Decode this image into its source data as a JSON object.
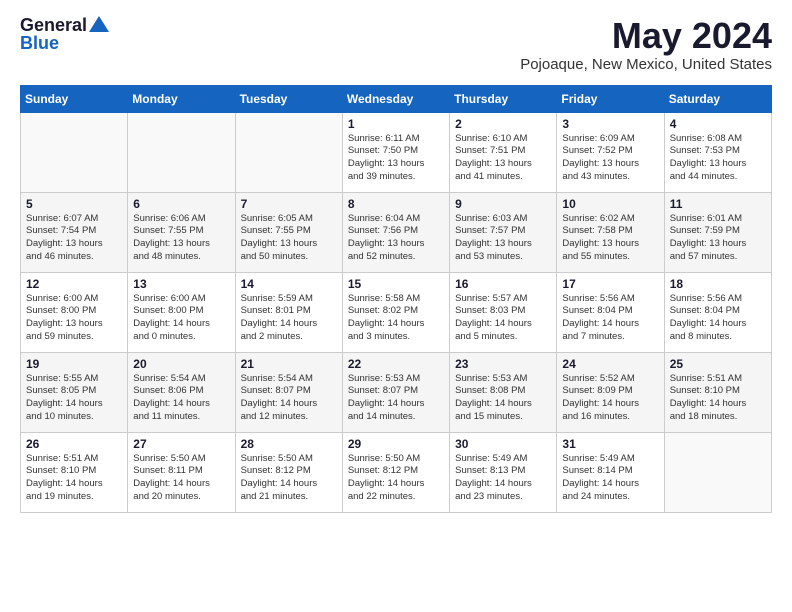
{
  "header": {
    "logo_general": "General",
    "logo_blue": "Blue",
    "month_title": "May 2024",
    "location": "Pojoaque, New Mexico, United States"
  },
  "days_of_week": [
    "Sunday",
    "Monday",
    "Tuesday",
    "Wednesday",
    "Thursday",
    "Friday",
    "Saturday"
  ],
  "weeks": [
    [
      {
        "day": "",
        "info": ""
      },
      {
        "day": "",
        "info": ""
      },
      {
        "day": "",
        "info": ""
      },
      {
        "day": "1",
        "info": "Sunrise: 6:11 AM\nSunset: 7:50 PM\nDaylight: 13 hours\nand 39 minutes."
      },
      {
        "day": "2",
        "info": "Sunrise: 6:10 AM\nSunset: 7:51 PM\nDaylight: 13 hours\nand 41 minutes."
      },
      {
        "day": "3",
        "info": "Sunrise: 6:09 AM\nSunset: 7:52 PM\nDaylight: 13 hours\nand 43 minutes."
      },
      {
        "day": "4",
        "info": "Sunrise: 6:08 AM\nSunset: 7:53 PM\nDaylight: 13 hours\nand 44 minutes."
      }
    ],
    [
      {
        "day": "5",
        "info": "Sunrise: 6:07 AM\nSunset: 7:54 PM\nDaylight: 13 hours\nand 46 minutes."
      },
      {
        "day": "6",
        "info": "Sunrise: 6:06 AM\nSunset: 7:55 PM\nDaylight: 13 hours\nand 48 minutes."
      },
      {
        "day": "7",
        "info": "Sunrise: 6:05 AM\nSunset: 7:55 PM\nDaylight: 13 hours\nand 50 minutes."
      },
      {
        "day": "8",
        "info": "Sunrise: 6:04 AM\nSunset: 7:56 PM\nDaylight: 13 hours\nand 52 minutes."
      },
      {
        "day": "9",
        "info": "Sunrise: 6:03 AM\nSunset: 7:57 PM\nDaylight: 13 hours\nand 53 minutes."
      },
      {
        "day": "10",
        "info": "Sunrise: 6:02 AM\nSunset: 7:58 PM\nDaylight: 13 hours\nand 55 minutes."
      },
      {
        "day": "11",
        "info": "Sunrise: 6:01 AM\nSunset: 7:59 PM\nDaylight: 13 hours\nand 57 minutes."
      }
    ],
    [
      {
        "day": "12",
        "info": "Sunrise: 6:00 AM\nSunset: 8:00 PM\nDaylight: 13 hours\nand 59 minutes."
      },
      {
        "day": "13",
        "info": "Sunrise: 6:00 AM\nSunset: 8:00 PM\nDaylight: 14 hours\nand 0 minutes."
      },
      {
        "day": "14",
        "info": "Sunrise: 5:59 AM\nSunset: 8:01 PM\nDaylight: 14 hours\nand 2 minutes."
      },
      {
        "day": "15",
        "info": "Sunrise: 5:58 AM\nSunset: 8:02 PM\nDaylight: 14 hours\nand 3 minutes."
      },
      {
        "day": "16",
        "info": "Sunrise: 5:57 AM\nSunset: 8:03 PM\nDaylight: 14 hours\nand 5 minutes."
      },
      {
        "day": "17",
        "info": "Sunrise: 5:56 AM\nSunset: 8:04 PM\nDaylight: 14 hours\nand 7 minutes."
      },
      {
        "day": "18",
        "info": "Sunrise: 5:56 AM\nSunset: 8:04 PM\nDaylight: 14 hours\nand 8 minutes."
      }
    ],
    [
      {
        "day": "19",
        "info": "Sunrise: 5:55 AM\nSunset: 8:05 PM\nDaylight: 14 hours\nand 10 minutes."
      },
      {
        "day": "20",
        "info": "Sunrise: 5:54 AM\nSunset: 8:06 PM\nDaylight: 14 hours\nand 11 minutes."
      },
      {
        "day": "21",
        "info": "Sunrise: 5:54 AM\nSunset: 8:07 PM\nDaylight: 14 hours\nand 12 minutes."
      },
      {
        "day": "22",
        "info": "Sunrise: 5:53 AM\nSunset: 8:07 PM\nDaylight: 14 hours\nand 14 minutes."
      },
      {
        "day": "23",
        "info": "Sunrise: 5:53 AM\nSunset: 8:08 PM\nDaylight: 14 hours\nand 15 minutes."
      },
      {
        "day": "24",
        "info": "Sunrise: 5:52 AM\nSunset: 8:09 PM\nDaylight: 14 hours\nand 16 minutes."
      },
      {
        "day": "25",
        "info": "Sunrise: 5:51 AM\nSunset: 8:10 PM\nDaylight: 14 hours\nand 18 minutes."
      }
    ],
    [
      {
        "day": "26",
        "info": "Sunrise: 5:51 AM\nSunset: 8:10 PM\nDaylight: 14 hours\nand 19 minutes."
      },
      {
        "day": "27",
        "info": "Sunrise: 5:50 AM\nSunset: 8:11 PM\nDaylight: 14 hours\nand 20 minutes."
      },
      {
        "day": "28",
        "info": "Sunrise: 5:50 AM\nSunset: 8:12 PM\nDaylight: 14 hours\nand 21 minutes."
      },
      {
        "day": "29",
        "info": "Sunrise: 5:50 AM\nSunset: 8:12 PM\nDaylight: 14 hours\nand 22 minutes."
      },
      {
        "day": "30",
        "info": "Sunrise: 5:49 AM\nSunset: 8:13 PM\nDaylight: 14 hours\nand 23 minutes."
      },
      {
        "day": "31",
        "info": "Sunrise: 5:49 AM\nSunset: 8:14 PM\nDaylight: 14 hours\nand 24 minutes."
      },
      {
        "day": "",
        "info": ""
      }
    ]
  ]
}
